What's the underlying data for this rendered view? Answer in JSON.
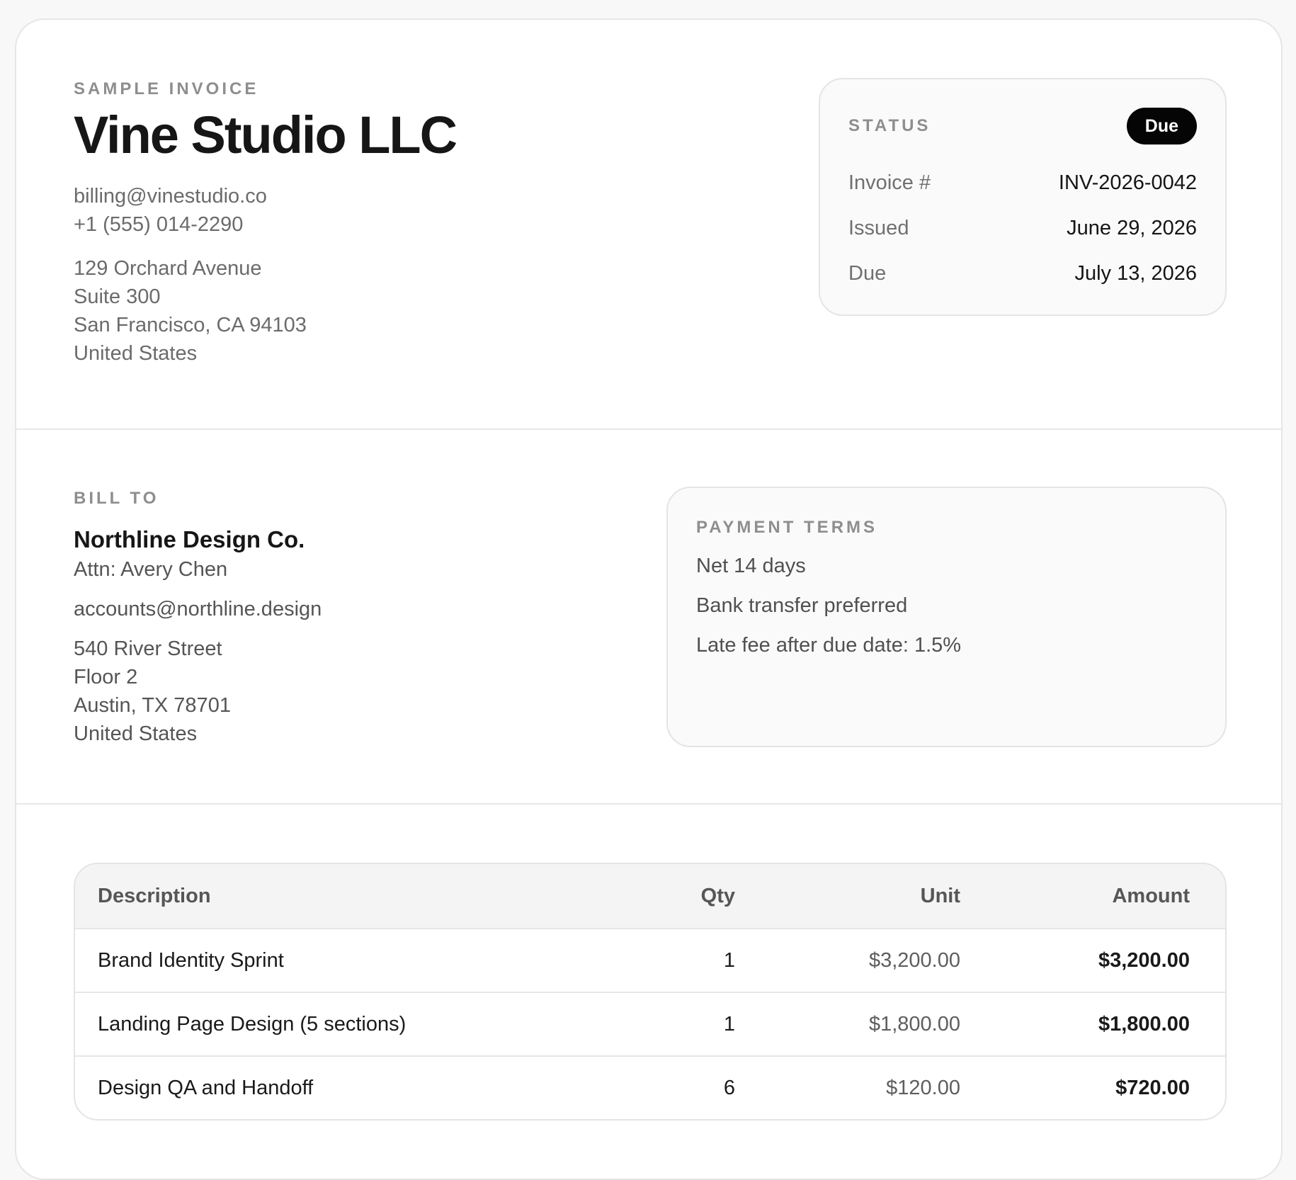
{
  "header": {
    "eyebrow": "SAMPLE INVOICE",
    "company": "Vine Studio LLC",
    "email": "billing@vinestudio.co",
    "phone": "+1 (555) 014-2290",
    "address": [
      "129 Orchard Avenue",
      "Suite 300",
      "San Francisco, CA 94103",
      "United States"
    ]
  },
  "status": {
    "label": "STATUS",
    "badge": "Due",
    "rows": [
      {
        "key": "Invoice #",
        "value": "INV-2026-0042"
      },
      {
        "key": "Issued",
        "value": "June 29, 2026"
      },
      {
        "key": "Due",
        "value": "July 13, 2026"
      }
    ]
  },
  "bill_to": {
    "label": "BILL TO",
    "client": "Northline Design Co.",
    "attn": "Attn: Avery Chen",
    "email": "accounts@northline.design",
    "address": [
      "540 River Street",
      "Floor 2",
      "Austin, TX 78701",
      "United States"
    ]
  },
  "payment_terms": {
    "label": "PAYMENT TERMS",
    "lines": [
      "Net 14 days",
      "Bank transfer preferred",
      "Late fee after due date: 1.5%"
    ]
  },
  "table": {
    "columns": [
      "Description",
      "Qty",
      "Unit",
      "Amount"
    ],
    "rows": [
      {
        "description": "Brand Identity Sprint",
        "qty": "1",
        "unit": "$3,200.00",
        "amount": "$3,200.00"
      },
      {
        "description": "Landing Page Design (5 sections)",
        "qty": "1",
        "unit": "$1,800.00",
        "amount": "$1,800.00"
      },
      {
        "description": "Design QA and Handoff",
        "qty": "6",
        "unit": "$120.00",
        "amount": "$720.00"
      }
    ]
  },
  "colors": {
    "badge_bg": "#050505",
    "badge_text": "#ffffff",
    "page_bg": "#f8f8f8",
    "card_bg": "#ffffff"
  }
}
